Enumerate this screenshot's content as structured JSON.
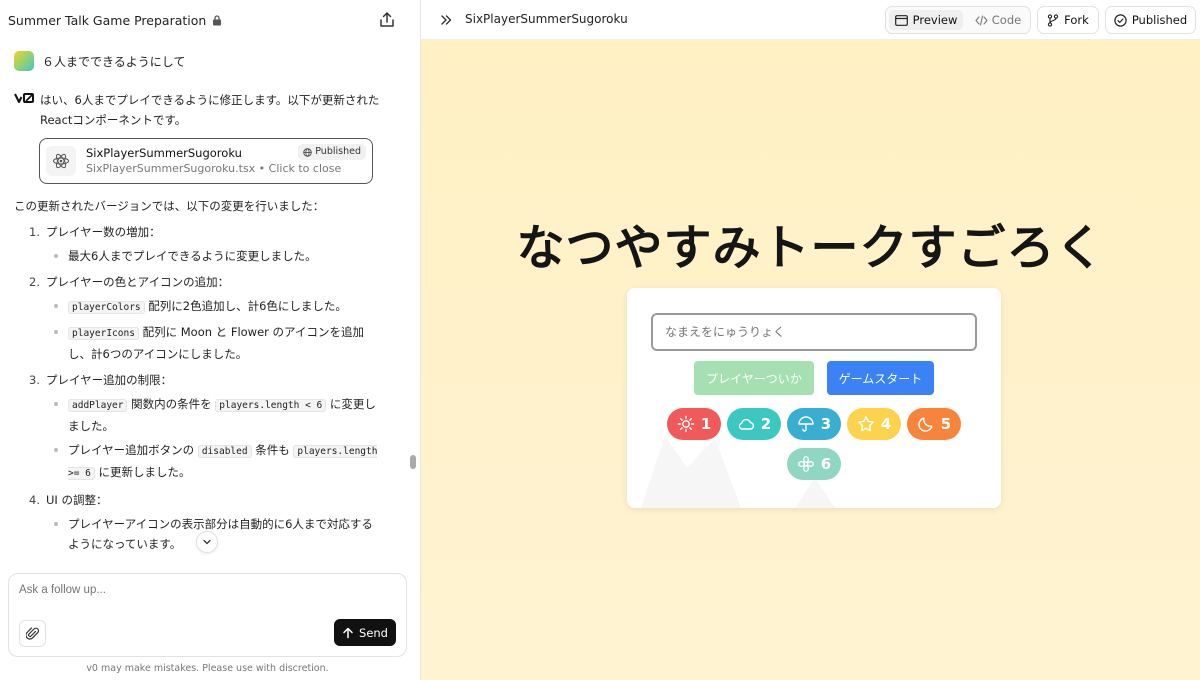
{
  "left_header": {
    "project_title": "Summer Talk Game Preparation"
  },
  "user_message": "６人までできるようにして",
  "ai": {
    "intro": "はい、6人までプレイできるように修正します。以下が更新されたReactコンポーネントです。",
    "artifact": {
      "title": "SixPlayerSummerSugoroku",
      "subtitle": "SixPlayerSummerSugoroku.tsx • Click to close",
      "badge": "Published"
    },
    "description": "この更新されたバージョンでは、以下の変更を行いました：",
    "items": [
      {
        "num": "1.",
        "title": "プレイヤー数の増加：",
        "bullets": [
          "最大6人までプレイできるように変更しました。"
        ]
      },
      {
        "num": "2.",
        "title": "プレイヤーの色とアイコンの追加：",
        "bullets": []
      },
      {
        "num": "3.",
        "title": "プレイヤー追加の制限：",
        "bullets": []
      },
      {
        "num": "4.",
        "title": "UI の調整：",
        "bullets": [
          "プレイヤーアイコンの表示部分は自動的に6人まで対応するようになっています。"
        ]
      }
    ],
    "item2": {
      "b1_code": "playerColors",
      "b1_text": " 配列に2色追加し、計6色にしました。",
      "b2_code": "playerIcons",
      "b2_text": " 配列に Moon と Flower のアイコンを追加し、計6つのアイコンにしました。"
    },
    "item3": {
      "b1_code1": "addPlayer",
      "b1_text1": " 関数内の条件を ",
      "b1_code2": "players.length < 6",
      "b1_text2": " に変更しました。",
      "b2_text1": "プレイヤー追加ボタンの ",
      "b2_code1": "disabled",
      "b2_text2": " 条件も ",
      "b2_code2": "players.length >= 6",
      "b2_text3": " に更新しました。"
    }
  },
  "composer": {
    "placeholder": "Ask a follow up...",
    "send_label": "Send"
  },
  "disclaimer": "v0 may make mistakes. Please use with discretion.",
  "topbar": {
    "component_name": "SixPlayerSummerSugoroku",
    "preview_label": "Preview",
    "code_label": "Code",
    "fork_label": "Fork",
    "published_label": "Published"
  },
  "game": {
    "title": "なつやすみトークすごろく",
    "name_placeholder": "なまえをにゅうりょく",
    "add_player_label": "プレイヤーついか",
    "start_label": "ゲームスタート",
    "players": [
      {
        "num": "1",
        "icon": "sun-icon",
        "color": "#f05a5a"
      },
      {
        "num": "2",
        "icon": "cloud-icon",
        "color": "#3cc7c0"
      },
      {
        "num": "3",
        "icon": "umbrella-icon",
        "color": "#3aaed0"
      },
      {
        "num": "4",
        "icon": "star-icon",
        "color": "#fcd34d"
      },
      {
        "num": "5",
        "icon": "moon-icon",
        "color": "#f7843a"
      },
      {
        "num": "6",
        "icon": "flower-icon",
        "color": "#8fd6c3"
      }
    ]
  },
  "colors": {
    "accent_blue": "#3b82f6",
    "add_button_green": "#a5dfb2",
    "preview_bg": "#fff1c4"
  }
}
